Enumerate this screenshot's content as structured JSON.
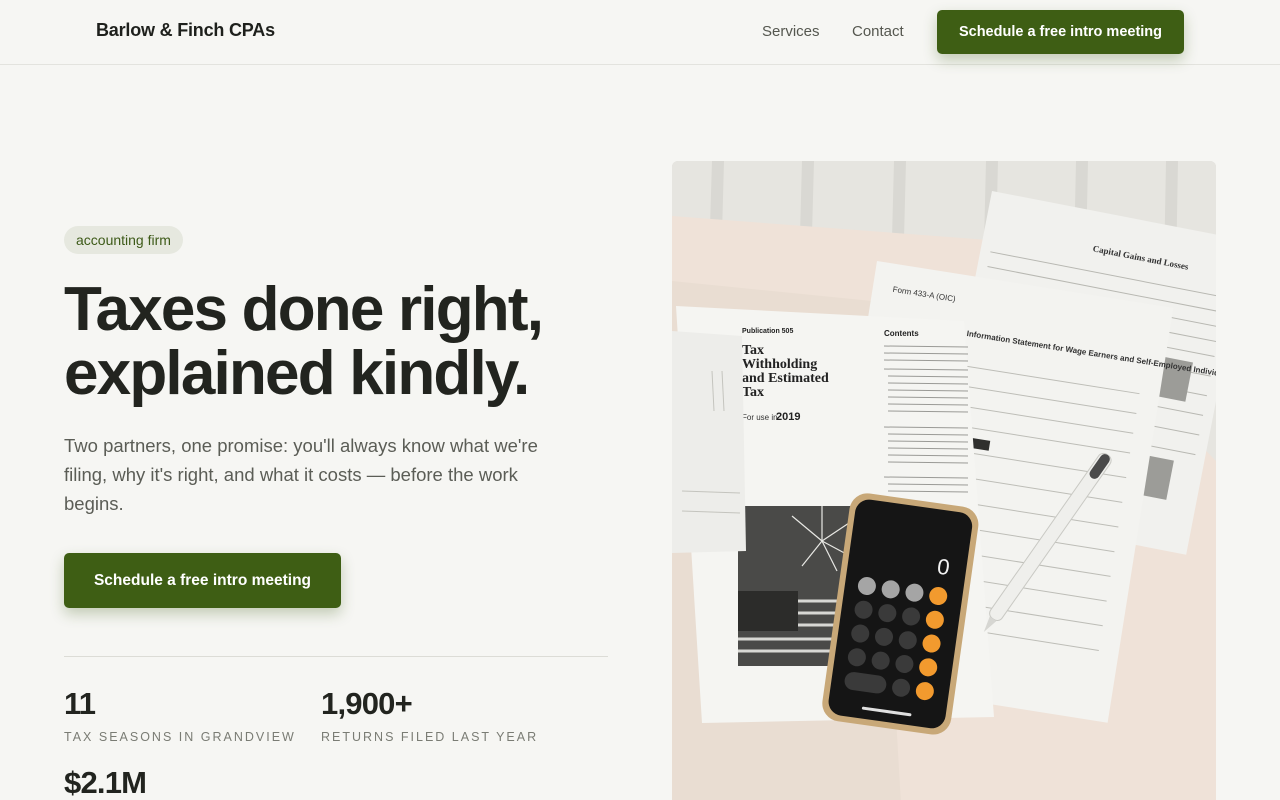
{
  "header": {
    "brand": "Barlow & Finch CPAs",
    "nav": [
      {
        "label": "Services"
      },
      {
        "label": "Contact"
      }
    ],
    "cta_label": "Schedule a free intro meeting"
  },
  "hero": {
    "tag": "accounting firm",
    "headline_line1": "Taxes done right,",
    "headline_line2": "explained kindly.",
    "lede": "Two partners, one promise: you'll always know what we're filing, why it's right, and what it costs — before the work begins.",
    "cta_label": "Schedule a free intro meeting",
    "stats": [
      {
        "value": "11",
        "label": "Tax seasons in Grandview"
      },
      {
        "value": "1,900+",
        "label": "Returns filed last year"
      },
      {
        "value": "$2.1M",
        "label": ""
      }
    ],
    "image": {
      "publication": "Publication 505",
      "title_line1": "Tax",
      "title_line2": "Withholding",
      "title_line3": "and Estimated",
      "title_line4": "Tax",
      "for_use_in": "For use in",
      "year": "2019",
      "contents_heading": "Contents",
      "form_433a": "Form 433-A (OIC)",
      "info_statement": "Information Statement for Wage Earners and Self-Employed Individuals",
      "schedule_d_title": "Capital Gains and Losses",
      "calc_display": "0"
    }
  },
  "colors": {
    "accent": "#3e5e14",
    "background": "#f6f6f3",
    "text": "#22241f"
  }
}
